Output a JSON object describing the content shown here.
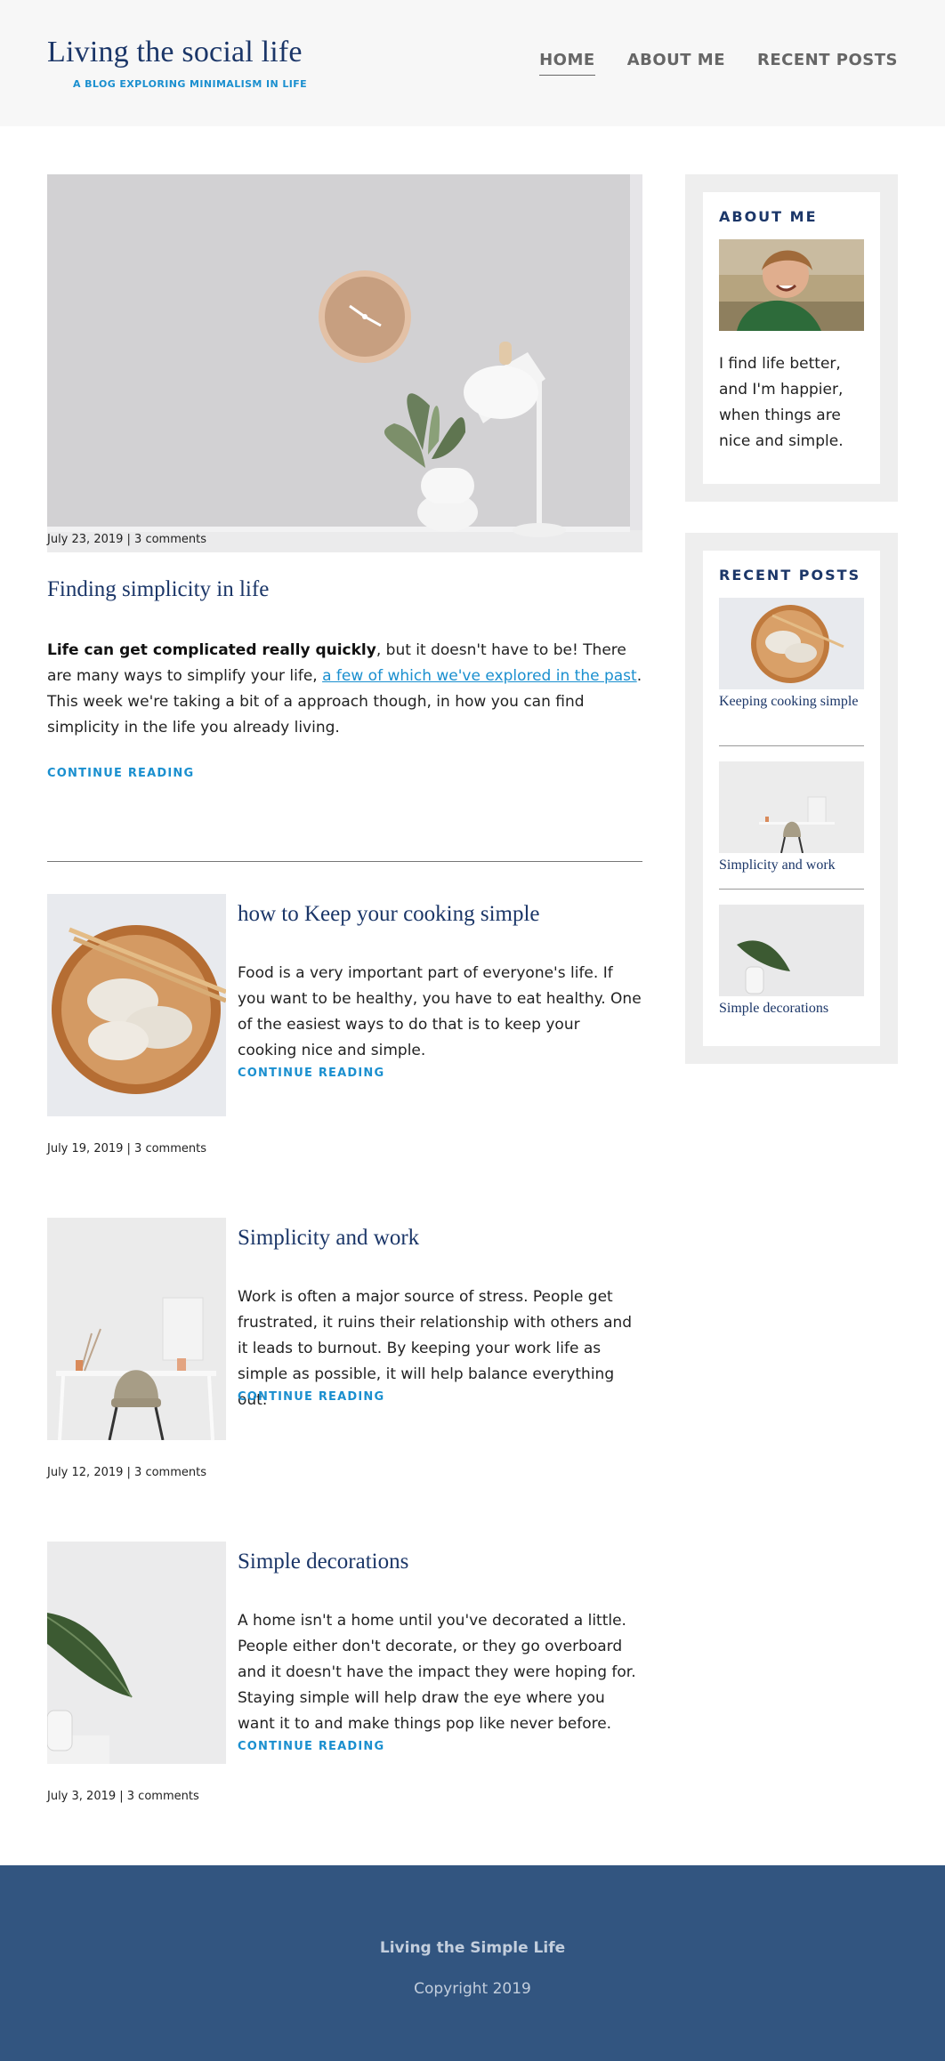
{
  "header": {
    "title": "Living the social life",
    "tagline": "A BLOG EXPLORING MINIMALISM IN LIFE",
    "nav": [
      "HOME",
      "ABOUT ME",
      "RECENT POSTS"
    ]
  },
  "featured": {
    "meta": "July 23, 2019 | 3 comments",
    "title": "Finding simplicity in life",
    "lead_bold": "Life can get complicated really quickly",
    "lead_1": ", but it doesn't have to be! There are many ways to simplify your life, ",
    "link": "a few of which we've explored in the past",
    "lead_2": ". This week we're taking a bit of a approach though, in how you can find simplicity in the life you already living.",
    "continue": "CONTINUE READING"
  },
  "posts": [
    {
      "title": "how to Keep your cooking simple",
      "body": "Food is a very important part of everyone's life. If you want to be healthy, you have to eat healthy. One of the easiest ways to do that is to keep your cooking nice and simple.",
      "continue": "CONTINUE READING",
      "meta": "July 19, 2019 | 3 comments"
    },
    {
      "title": "Simplicity and work",
      "body": "Work is often a major source of stress. People get frustrated, it ruins their relationship with others and it leads to burnout. By keeping your work life as simple as possible, it will help balance everything out.",
      "continue": "CONTINUE READING",
      "meta": "July 12, 2019 | 3 comments"
    },
    {
      "title": "Simple decorations",
      "body": "A home isn't a home until you've decorated a little. People either don't decorate, or they go overboard and it doesn't have the impact they were hoping for. Staying simple will help draw the eye where you want it to and make things pop like never before.",
      "continue": "CONTINUE READING",
      "meta": "July 3, 2019 | 3 comments"
    }
  ],
  "sidebar": {
    "about_title": "ABOUT ME",
    "about_text": "I find life better, and I'm happier, when things are nice and simple.",
    "recent_title": "RECENT POSTS",
    "recent": [
      "Keeping cooking simple",
      "Simplicity and work",
      "Simple decorations"
    ]
  },
  "footer": {
    "title": "Living the Simple Life",
    "copyright": "Copyright 2019"
  },
  "colors": {
    "brand": "#1b3668",
    "accent": "#1a8fcf",
    "footer": "#325580"
  }
}
